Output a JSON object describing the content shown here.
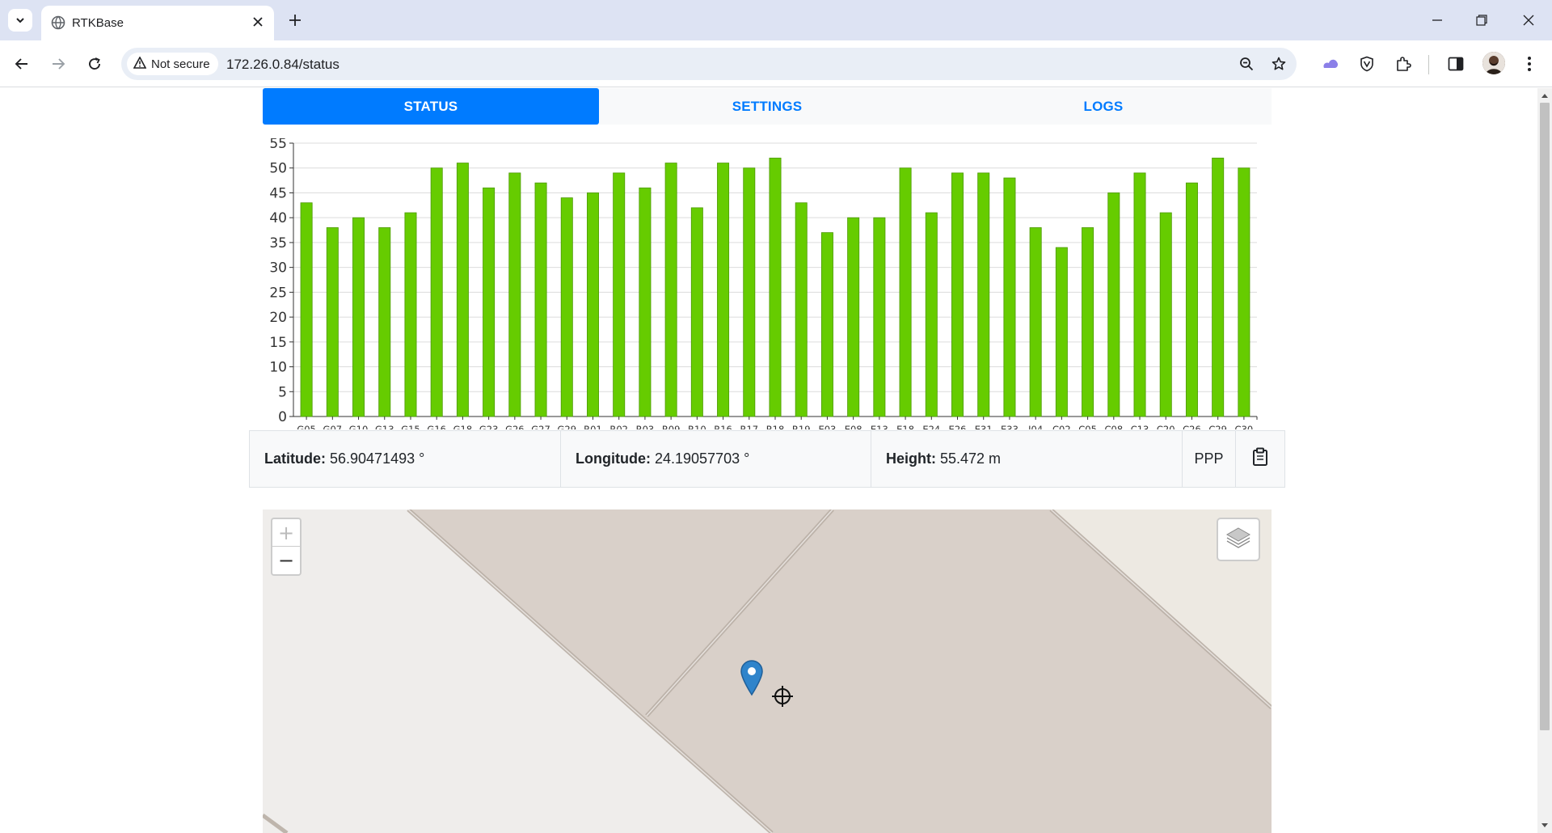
{
  "browser": {
    "tab_title": "RTKBase",
    "security_label": "Not secure",
    "url": "172.26.0.84/status",
    "icons": [
      "tab-search-icon",
      "globe-icon",
      "close-icon",
      "plus-icon",
      "minimize-icon",
      "restore-icon",
      "back-arrow-icon",
      "forward-arrow-icon",
      "reload-icon",
      "warning-icon",
      "zoom-icon",
      "star-icon",
      "extension-icon",
      "sidebar-icon",
      "menu-icon"
    ]
  },
  "nav": {
    "tabs": [
      {
        "label": "STATUS",
        "active": true
      },
      {
        "label": "SETTINGS",
        "active": false
      },
      {
        "label": "LOGS",
        "active": false
      }
    ]
  },
  "chart_data": {
    "type": "bar",
    "categories": [
      "G05",
      "G07",
      "G10",
      "G13",
      "G15",
      "G16",
      "G18",
      "G23",
      "G26",
      "G27",
      "G29",
      "R01",
      "R02",
      "R03",
      "R09",
      "R10",
      "R16",
      "R17",
      "R18",
      "R19",
      "E03",
      "E08",
      "E13",
      "E18",
      "E24",
      "E26",
      "E31",
      "E33",
      "J04",
      "C02",
      "C05",
      "C08",
      "C13",
      "C20",
      "C26",
      "C29",
      "C30"
    ],
    "values": [
      43,
      38,
      40,
      38,
      41,
      50,
      51,
      46,
      49,
      47,
      44,
      45,
      49,
      46,
      51,
      42,
      51,
      50,
      52,
      43,
      37,
      40,
      40,
      50,
      41,
      49,
      49,
      48,
      38,
      34,
      38,
      45,
      49,
      41,
      47,
      52,
      50
    ],
    "ylim": [
      0,
      55
    ],
    "yticks": [
      0,
      5,
      10,
      15,
      20,
      25,
      30,
      35,
      40,
      45,
      50,
      55
    ],
    "bar_color": "#66cc00",
    "grid": true,
    "title": "",
    "xlabel": "",
    "ylabel": ""
  },
  "position": {
    "latitude_label": "Latitude:",
    "latitude_value": "56.90471493 °",
    "longitude_label": "Longitude:",
    "longitude_value": "24.19057703 °",
    "height_label": "Height:",
    "height_value": "55.472 m",
    "mode": "PPP",
    "copy_icon": "clipboard-icon"
  },
  "map": {
    "zoom_in_label": "+",
    "zoom_out_label": "−",
    "layers_icon": "layers-icon",
    "marker_icon": "map-marker-icon",
    "crosshair_icon": "crosshair-icon"
  }
}
